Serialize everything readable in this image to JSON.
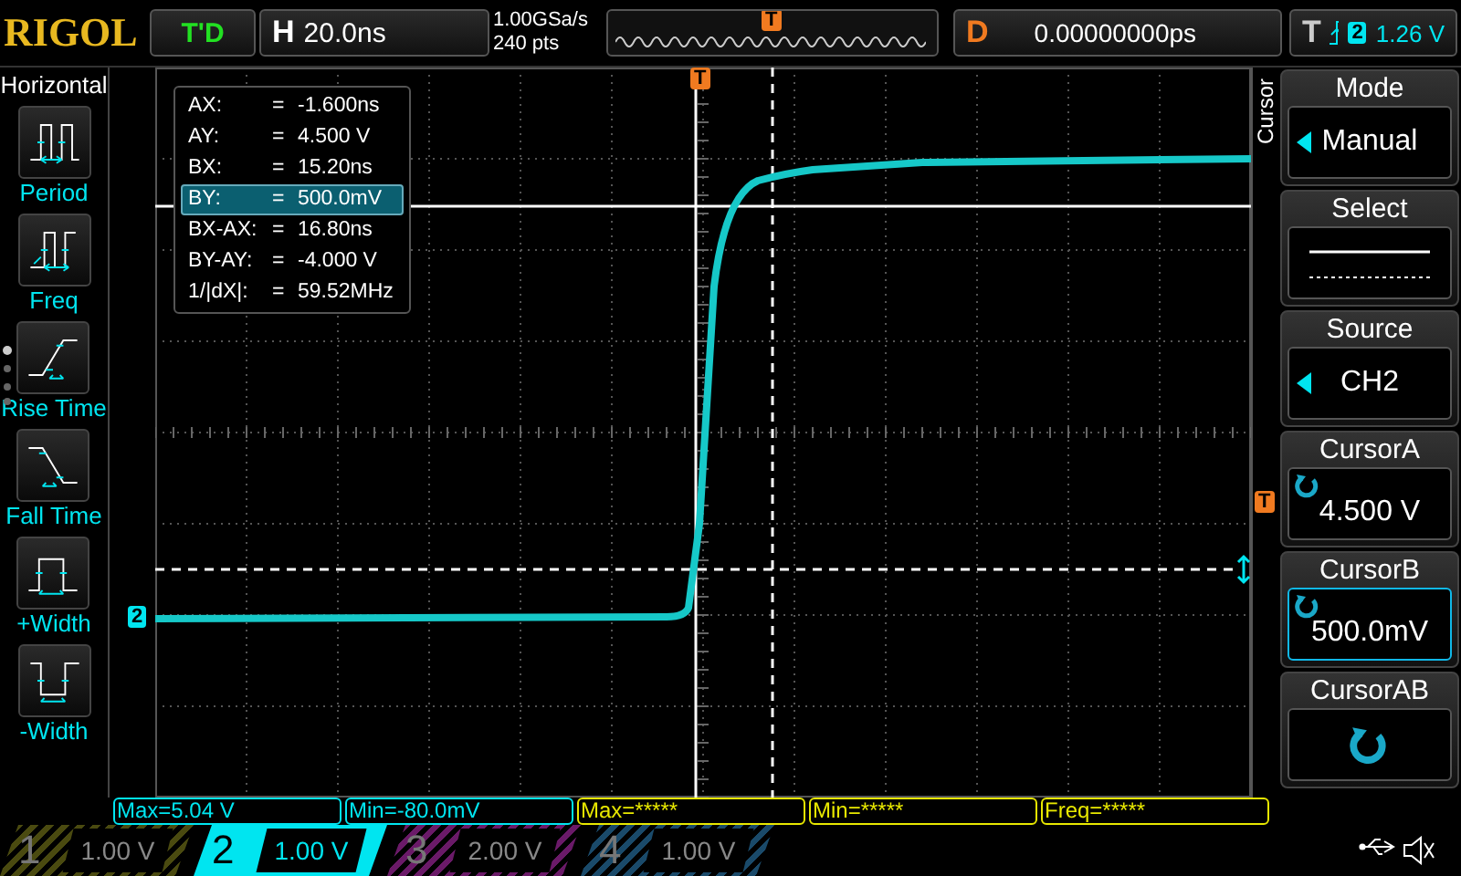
{
  "logo": "RIGOL",
  "run_status": "T'D",
  "timebase": {
    "label": "H",
    "value": "20.0ns"
  },
  "sample_rate": "1.00GSa/s",
  "memory_depth": "240 pts",
  "delay": {
    "label": "D",
    "value": "0.00000000ps"
  },
  "trigger": {
    "label": "T",
    "source": "2",
    "level": "1.26 V"
  },
  "left_menu": {
    "title": "Horizontal",
    "items": [
      {
        "label": "Period",
        "kind": "period"
      },
      {
        "label": "Freq",
        "kind": "freq"
      },
      {
        "label": "Rise Time",
        "kind": "rise"
      },
      {
        "label": "Fall Time",
        "kind": "fall"
      },
      {
        "label": "+Width",
        "kind": "pwidth"
      },
      {
        "label": "-Width",
        "kind": "nwidth"
      }
    ]
  },
  "markers": {
    "overview_trigger": "T",
    "trigger_position": "T",
    "trigger_level": "T",
    "channel": "2"
  },
  "cursor_readout": [
    {
      "label": "AX:",
      "eq": "=",
      "value": "-1.600ns",
      "selected": false
    },
    {
      "label": "AY:",
      "eq": "=",
      "value": "4.500 V",
      "selected": false
    },
    {
      "label": "BX:",
      "eq": "=",
      "value": "15.20ns",
      "selected": false
    },
    {
      "label": "BY:",
      "eq": "=",
      "value": "500.0mV",
      "selected": true
    },
    {
      "label": "BX-AX:",
      "eq": "=",
      "value": "16.80ns",
      "selected": false
    },
    {
      "label": "BY-AY:",
      "eq": "=",
      "value": "-4.000 V",
      "selected": false
    },
    {
      "label": "1/|dX|:",
      "eq": "=",
      "value": "59.52MHz",
      "selected": false
    }
  ],
  "side_tab": "Cursor",
  "right_menu": [
    {
      "title": "Mode",
      "kind": "option",
      "value": "Manual",
      "selected": false
    },
    {
      "title": "Select",
      "kind": "lines",
      "selected": false
    },
    {
      "title": "Source",
      "kind": "option",
      "value": "CH2",
      "selected": false
    },
    {
      "title": "CursorA",
      "kind": "knob",
      "value": "4.500 V",
      "selected": false
    },
    {
      "title": "CursorB",
      "kind": "knob",
      "value": "500.0mV",
      "selected": true
    },
    {
      "title": "CursorAB",
      "kind": "knob",
      "selected": false
    }
  ],
  "measurements": [
    {
      "text": "Max=5.04 V",
      "color": "#00e5f0"
    },
    {
      "text": "Min=-80.0mV",
      "color": "#00e5f0"
    },
    {
      "text": "Max=*****",
      "color": "#e8e800"
    },
    {
      "text": "Min=*****",
      "color": "#e8e800"
    },
    {
      "text": "Freq=*****",
      "color": "#e8e800"
    }
  ],
  "channels": [
    {
      "number": "1",
      "scale": "1.00 V",
      "selected": false,
      "color": "#4a4a10"
    },
    {
      "number": "2",
      "scale": "1.00 V",
      "selected": true,
      "color": "#00e5f0"
    },
    {
      "number": "3",
      "scale": "2.00 V",
      "selected": false,
      "color": "#6a1a68"
    },
    {
      "number": "4",
      "scale": "1.00 V",
      "selected": false,
      "color": "#1a4a6a"
    }
  ]
}
